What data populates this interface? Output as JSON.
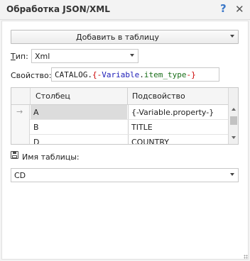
{
  "window": {
    "title": "Обработка JSON/XML",
    "help": "?",
    "close": "✕"
  },
  "add_button": {
    "label": "Добавить в таблицу"
  },
  "type": {
    "label_underlined": "Т",
    "label_rest": "ип:",
    "value": "Xml"
  },
  "property": {
    "label": "Свойство:",
    "segments": {
      "s1": "CATALOG.",
      "s2": "{-",
      "s3": "Variable",
      "s4": ".",
      "s5": "item_type",
      "s6": "-}"
    }
  },
  "grid": {
    "columns": [
      "Столбец",
      "Подсвойство"
    ],
    "rows": [
      {
        "col": "A",
        "sub": "{-Variable.property-}",
        "selected": true
      },
      {
        "col": "B",
        "sub": "TITLE"
      },
      {
        "col": "D",
        "sub": "COUNTRY"
      }
    ],
    "current_row_marker": "→"
  },
  "table_name": {
    "label": "Имя таблицы:",
    "value": "CD"
  }
}
